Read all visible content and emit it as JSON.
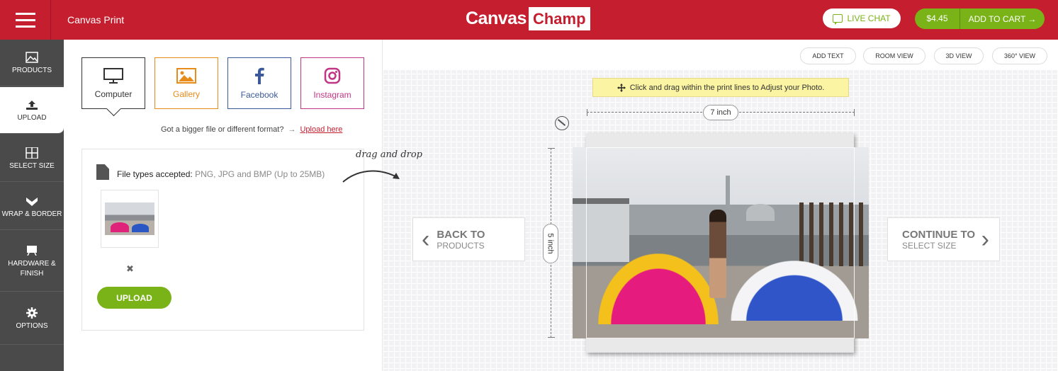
{
  "header": {
    "product_name": "Canvas Print",
    "logo_part1": "Canvas",
    "logo_part2": "Champ",
    "live_chat": "LIVE CHAT",
    "price": "$4.45",
    "add_to_cart": "ADD TO CART →"
  },
  "sidebar": {
    "items": [
      {
        "label": "PRODUCTS",
        "icon": "image-icon"
      },
      {
        "label": "UPLOAD",
        "icon": "upload-icon"
      },
      {
        "label": "SELECT SIZE",
        "icon": "grid-icon"
      },
      {
        "label": "WRAP & BORDER",
        "icon": "wrap-icon"
      },
      {
        "label": "HARDWARE &",
        "label2": "FINISH",
        "icon": "easel-icon"
      },
      {
        "label": "OPTIONS",
        "icon": "gear-icon"
      }
    ],
    "active_index": 1
  },
  "upload_panel": {
    "sources": [
      {
        "label": "Computer",
        "icon": "monitor-icon"
      },
      {
        "label": "Gallery",
        "icon": "gallery-icon"
      },
      {
        "label": "Facebook",
        "icon": "facebook-icon"
      },
      {
        "label": "Instagram",
        "icon": "instagram-icon"
      }
    ],
    "bigger_file_text": "Got a bigger file or different format?",
    "bigger_file_arrow": "→",
    "upload_here": "Upload here",
    "file_types_label": "File types accepted:",
    "file_types_value": "PNG, JPG and BMP (Up to 25MB)",
    "remove_symbol": "✖",
    "upload_button": "UPLOAD"
  },
  "drag_drop_hint": "drag and drop",
  "workspace": {
    "toolbar": [
      "ADD TEXT",
      "ROOM VIEW",
      "3D VIEW",
      "360° VIEW"
    ],
    "drag_note": "Click and drag within the print lines to Adjust your Photo.",
    "width_label": "7 inch",
    "height_label": "5 inch",
    "back": {
      "big": "BACK TO",
      "small": "PRODUCTS"
    },
    "continue": {
      "big": "CONTINUE TO",
      "small": "SELECT SIZE"
    }
  },
  "colors": {
    "brand_red": "#c41e2f",
    "green": "#7ab317",
    "sidebar_gray": "#4a4a4a"
  }
}
